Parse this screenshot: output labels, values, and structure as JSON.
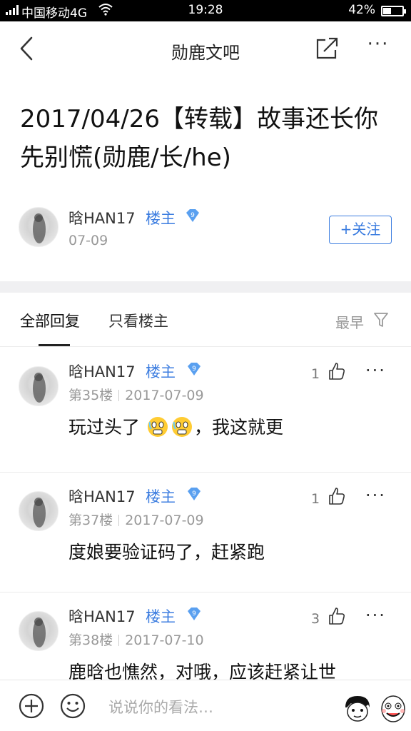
{
  "status_bar": {
    "carrier": "中国移动4G",
    "time": "19:28",
    "battery_pct": "42%",
    "battery_level": 0.42
  },
  "nav": {
    "title": "勋鹿文吧",
    "back_icon": "chevron-left-icon",
    "share_icon": "share-icon",
    "more_label": "···"
  },
  "post": {
    "title": "2017/04/26【转载】故事还长你先别慌(勋鹿/长/he)",
    "author": "晗HAN17",
    "owner_badge": "楼主",
    "level": "9",
    "date": "07-09",
    "follow_label": "+关注"
  },
  "tabs": {
    "all": "全部回复",
    "owner_only": "只看楼主",
    "sort": "最早"
  },
  "replies": [
    {
      "author": "晗HAN17",
      "badge": "楼主",
      "level": "9",
      "floor": "第35楼",
      "date": "2017-07-09",
      "likes": "1",
      "content_a": "玩过头了",
      "content_b": "，我这就更",
      "emoji_count": 2
    },
    {
      "author": "晗HAN17",
      "badge": "楼主",
      "level": "9",
      "floor": "第37楼",
      "date": "2017-07-09",
      "likes": "1",
      "content_a": "度娘要验证码了，赶紧跑",
      "content_b": "",
      "emoji_count": 0
    },
    {
      "author": "晗HAN17",
      "badge": "楼主",
      "level": "9",
      "floor": "第38楼",
      "date": "2017-07-10",
      "likes": "3",
      "content_a": "鹿晗也憔然，对哦，应该赶紧让世",
      "content_b": "",
      "emoji_count": 0
    }
  ],
  "bottom_bar": {
    "placeholder": "说说你的看法…"
  },
  "colors": {
    "accent": "#3c7de0",
    "level_badge": "#5aa0f0"
  }
}
